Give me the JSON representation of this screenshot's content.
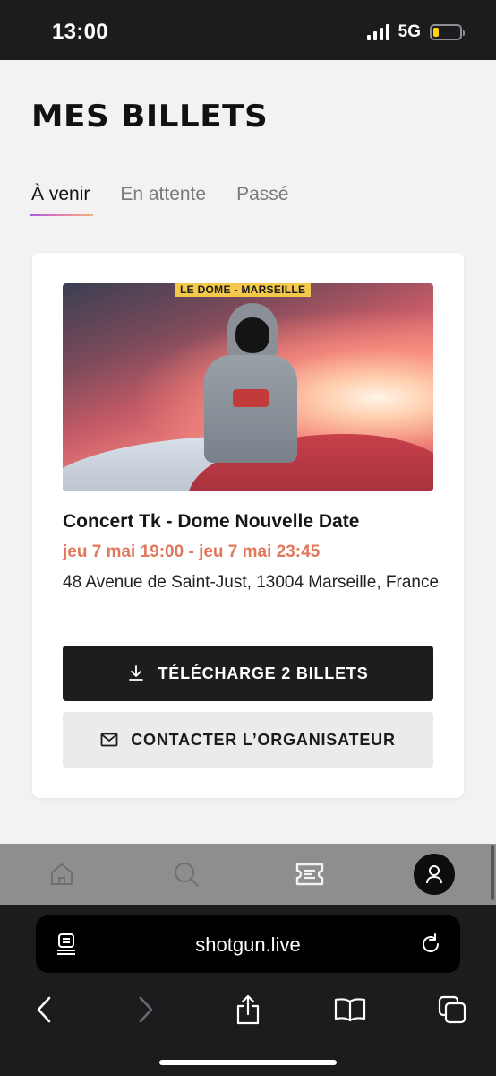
{
  "status_bar": {
    "time": "13:00",
    "network": "5G"
  },
  "app": {
    "page_title": "MES BILLETS",
    "tabs": [
      {
        "label": "À venir",
        "active": true
      },
      {
        "label": "En attente",
        "active": false
      },
      {
        "label": "Passé",
        "active": false
      }
    ],
    "event": {
      "image_banner": "LE DOME - MARSEILLE",
      "title": "Concert Tk - Dome Nouvelle Date",
      "date": "jeu 7 mai 19:00 - jeu 7 mai 23:45",
      "address": "48 Avenue de Saint-Just, 13004 Marseille, France",
      "download_label": "TÉLÉCHARGE 2 BILLETS",
      "contact_label": "CONTACTER L’ORGANISATEUR"
    },
    "bottom_nav": [
      "home-icon",
      "search-icon",
      "ticket-icon",
      "profile-icon"
    ]
  },
  "browser": {
    "url": "shotgun.live"
  },
  "colors": {
    "accent_date": "#e0795c",
    "tab_underline_start": "#a55be0",
    "tab_underline_end": "#f0b27a",
    "dark_button": "#1d1d1f"
  }
}
